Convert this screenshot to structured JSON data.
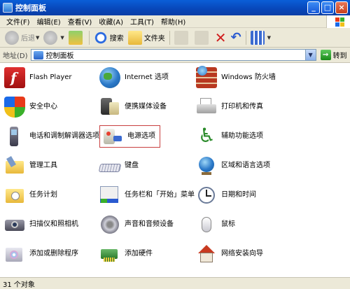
{
  "window": {
    "title": "控制面板",
    "buttons": [
      "_",
      "□",
      "×"
    ]
  },
  "menu": [
    "文件(F)",
    "编辑(E)",
    "查看(V)",
    "收藏(A)",
    "工具(T)",
    "帮助(H)"
  ],
  "toolbar": {
    "back": "后退",
    "search": "搜索",
    "folders": "文件夹"
  },
  "address": {
    "label": "地址(D)",
    "value": "控制面板",
    "go": "转到"
  },
  "items": [
    "Flash Player",
    "Internet 选项",
    "Windows 防火墙",
    "安全中心",
    "便携媒体设备",
    "打印机和传真",
    "电话和调制解调器选项",
    "电源选项",
    "辅助功能选项",
    "管理工具",
    "键盘",
    "区域和语言选项",
    "任务计划",
    "任务栏和「开始」菜单",
    "日期和时间",
    "扫描仪和照相机",
    "声音和音频设备",
    "鼠标",
    "添加或删除程序",
    "添加硬件",
    "网络安装向导"
  ],
  "status": "31 个对象",
  "colors": {
    "titlebar": "#0846b8",
    "chrome": "#ece9d8",
    "selection_border": "#c84040"
  }
}
